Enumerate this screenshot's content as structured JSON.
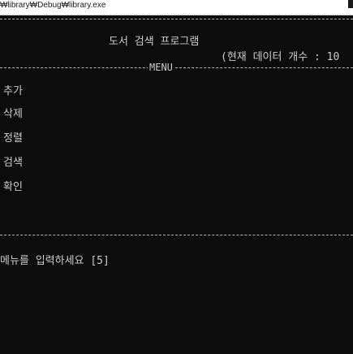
{
  "window": {
    "title": "₩library₩Debug₩library.exe"
  },
  "console": {
    "program_title": "도서 검색 프로그램",
    "data_count": "(현재 데이터 개수 : 10",
    "menu_label": "MENU",
    "menu_items": [
      {
        "label": "추가"
      },
      {
        "label": "삭제"
      },
      {
        "label": "정렬"
      },
      {
        "label": "검색"
      },
      {
        "label": "확인"
      }
    ],
    "prompt": "메뉴를 입력하세요 [5]"
  },
  "colors": {
    "background": "#0c0c0c",
    "text": "#cccccc",
    "rule": "#b5b5b5",
    "titlebar": "#ffffff"
  }
}
